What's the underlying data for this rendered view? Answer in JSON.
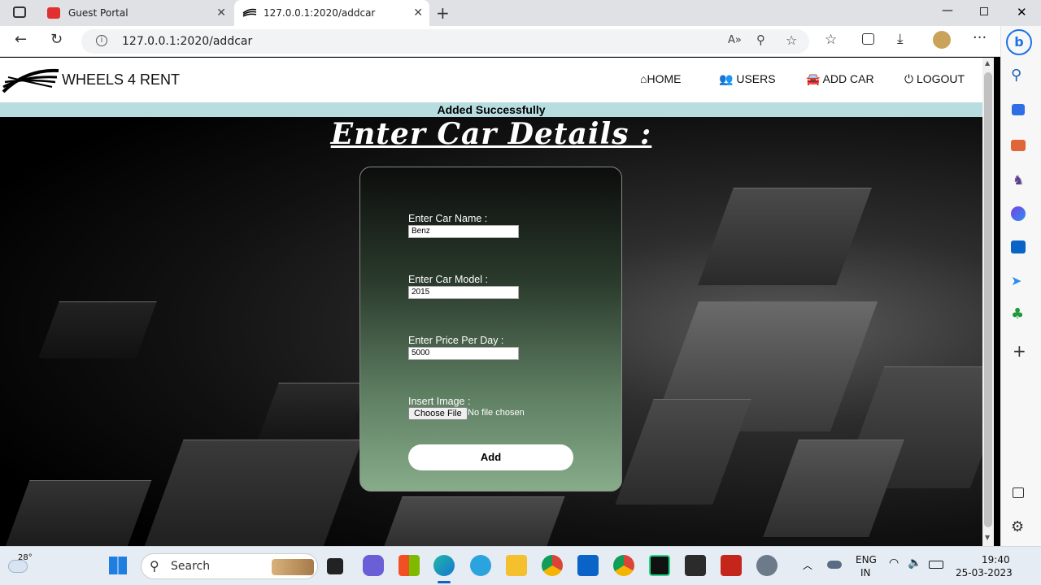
{
  "browser": {
    "tabs": [
      {
        "title": "Guest Portal"
      },
      {
        "title": "127.0.0.1:2020/addcar"
      }
    ],
    "url": "127.0.0.1:2020/addcar"
  },
  "site": {
    "logo_text": "WHEELS 4 RENT",
    "nav": {
      "home": "HOME",
      "users": "USERS",
      "add_car": "ADD CAR",
      "logout": "LOGOUT"
    },
    "message": "Added Successfully",
    "heading": "Enter Car Details :"
  },
  "form": {
    "car_name_label": "Enter Car Name :",
    "car_name_value": "Benz",
    "car_model_label": "Enter Car Model :",
    "car_model_value": "2015",
    "price_label": "Enter Price Per Day :",
    "price_value": "5000",
    "image_label": "Insert Image :",
    "choose_file": "Choose File",
    "no_file": "No file chosen",
    "submit": "Add"
  },
  "taskbar": {
    "weather_temp": "28°",
    "search_label": "Search",
    "lang_line1": "ENG",
    "lang_line2": "IN",
    "time": "19:40",
    "date": "25-03-2023"
  }
}
